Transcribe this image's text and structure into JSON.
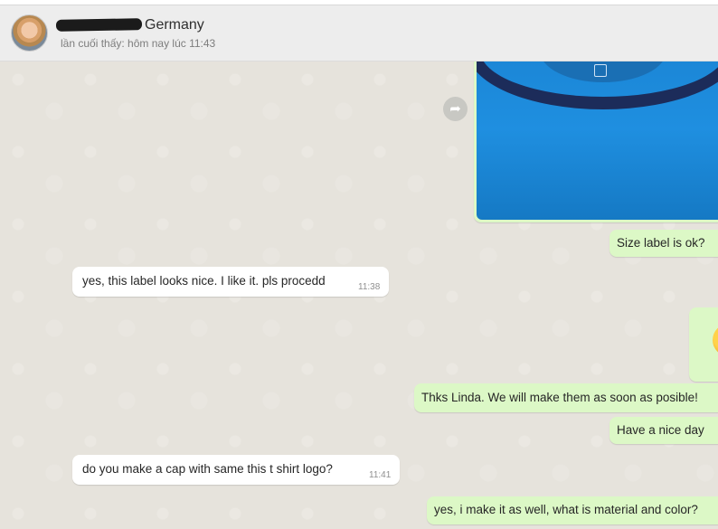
{
  "header": {
    "contact_name": "Germany",
    "last_seen": "lần cuối thấy: hôm nay lúc 11:43"
  },
  "messages": [
    {
      "text": "Size label is ok?"
    },
    {
      "text": "yes, this label looks nice. I like it. pls procedd",
      "time": "11:38"
    },
    {
      "text": "Thks Linda. We will make them as soon as posible!"
    },
    {
      "text": "Have a nice day"
    },
    {
      "text": "do you make a cap with same this t shirt logo?",
      "time": "11:41"
    },
    {
      "text": "yes, i make it as well, what is material and color?"
    }
  ],
  "icons": {
    "avatar": "contact-photo",
    "forward": "forward-arrow-icon",
    "sticker": "emoji-sticker"
  },
  "colors": {
    "incoming_bubble": "#ffffff",
    "outgoing_bubble": "#dcf8c6",
    "chat_background": "#e6e3dc",
    "header_background": "#ededed"
  }
}
